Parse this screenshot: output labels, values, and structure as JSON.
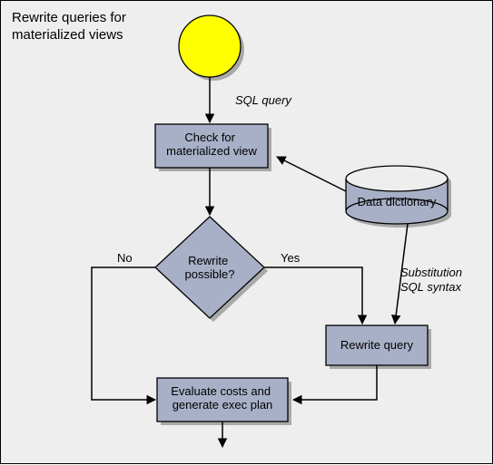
{
  "title": "Rewrite queries for\nmaterialized views",
  "labels": {
    "sql_query": "SQL query",
    "substitution": "Substitution\nSQL syntax"
  },
  "nodes": {
    "check": "Check for\nmaterialized view",
    "dictionary": "Data dictionary",
    "decision": "Rewrite\npossible?",
    "rewrite": "Rewrite query",
    "evaluate": "Evaluate costs and\ngenerate exec plan"
  },
  "edges": {
    "no": "No",
    "yes": "Yes"
  },
  "colors": {
    "box_fill": "#a8b0c7",
    "shadow": "#a9a9a9",
    "start_fill": "#ffff00"
  }
}
